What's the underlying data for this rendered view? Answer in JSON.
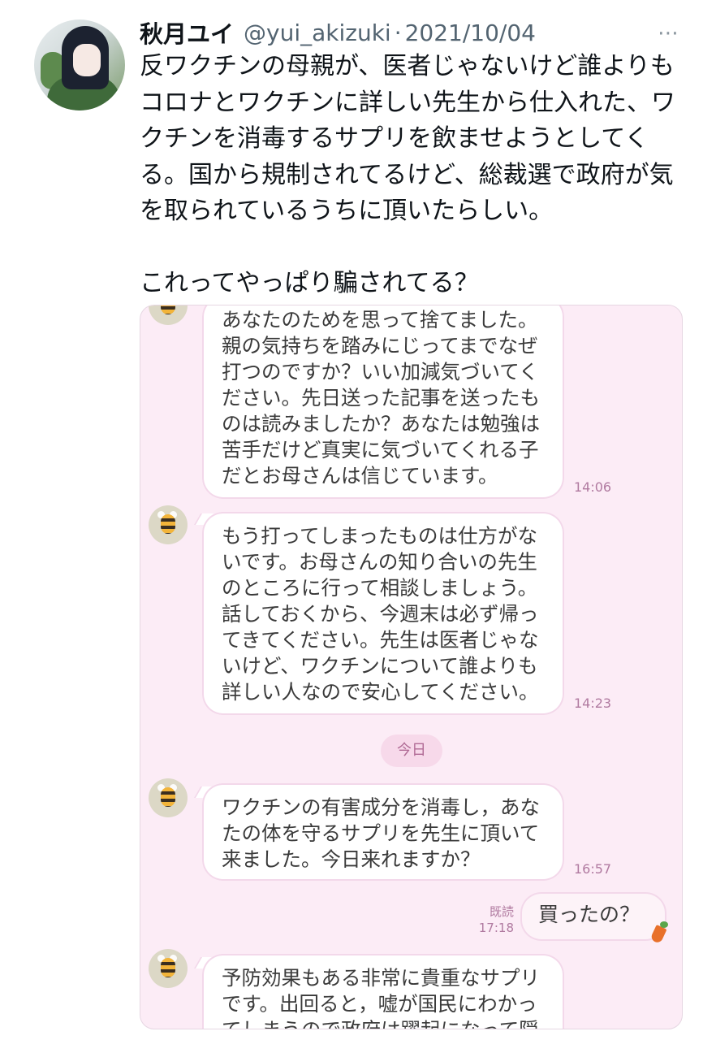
{
  "tweet": {
    "author_name": "秋月ユイ",
    "handle": "@yui_akizuki",
    "separator": "·",
    "date": "2021/10/04",
    "more_icon": "⋯",
    "text": "反ワクチンの母親が、医者じゃないけど誰よりもコロナとワクチンに詳しい先生から仕入れた、ワクチンを消毒するサプリを飲ませようとしてくる。国から規制されてるけど、総裁選で政府が気を取られているうちに頂いたらしい。\n\nこれってやっぱり騙されてる？"
  },
  "chat": {
    "messages": [
      {
        "text": "あなたのためを思って捨てました。\n親の気持ちを踏みにじってまでなぜ\n打つのですか？いい加減気づいてく\nださい。先日送った記事を送ったも\nのは読みましたか？あなたは勉強は\n苦手だけど真実に気づいてくれる子\nだとお母さんは信じています。",
        "time": "14:06"
      },
      {
        "text": "もう打ってしまったものは仕方がな\nいです。お母さんの知り合いの先生\nのところに行って相談しましょう。\n話しておくから、今週末は必ず帰っ\nてきてください。先生は医者じゃな\nいけど、ワクチンについて誰よりも\n詳しい人なので安心してください。",
        "time": "14:23"
      },
      {
        "text": "ワクチンの有害成分を消毒し，あな\nたの体を守るサプリを先生に頂いて\n来ました。今日来れますか？",
        "time": "16:57"
      },
      {
        "text": "予防効果もある非常に貴重なサプリ\nです。出回ると，嘘が国民にわかっ\nてしまうので政府は躍起になって隠",
        "time": ""
      }
    ],
    "date_divider": "今日",
    "reply": {
      "text": "買ったの？",
      "read_label": "既読",
      "time": "17:18"
    }
  }
}
